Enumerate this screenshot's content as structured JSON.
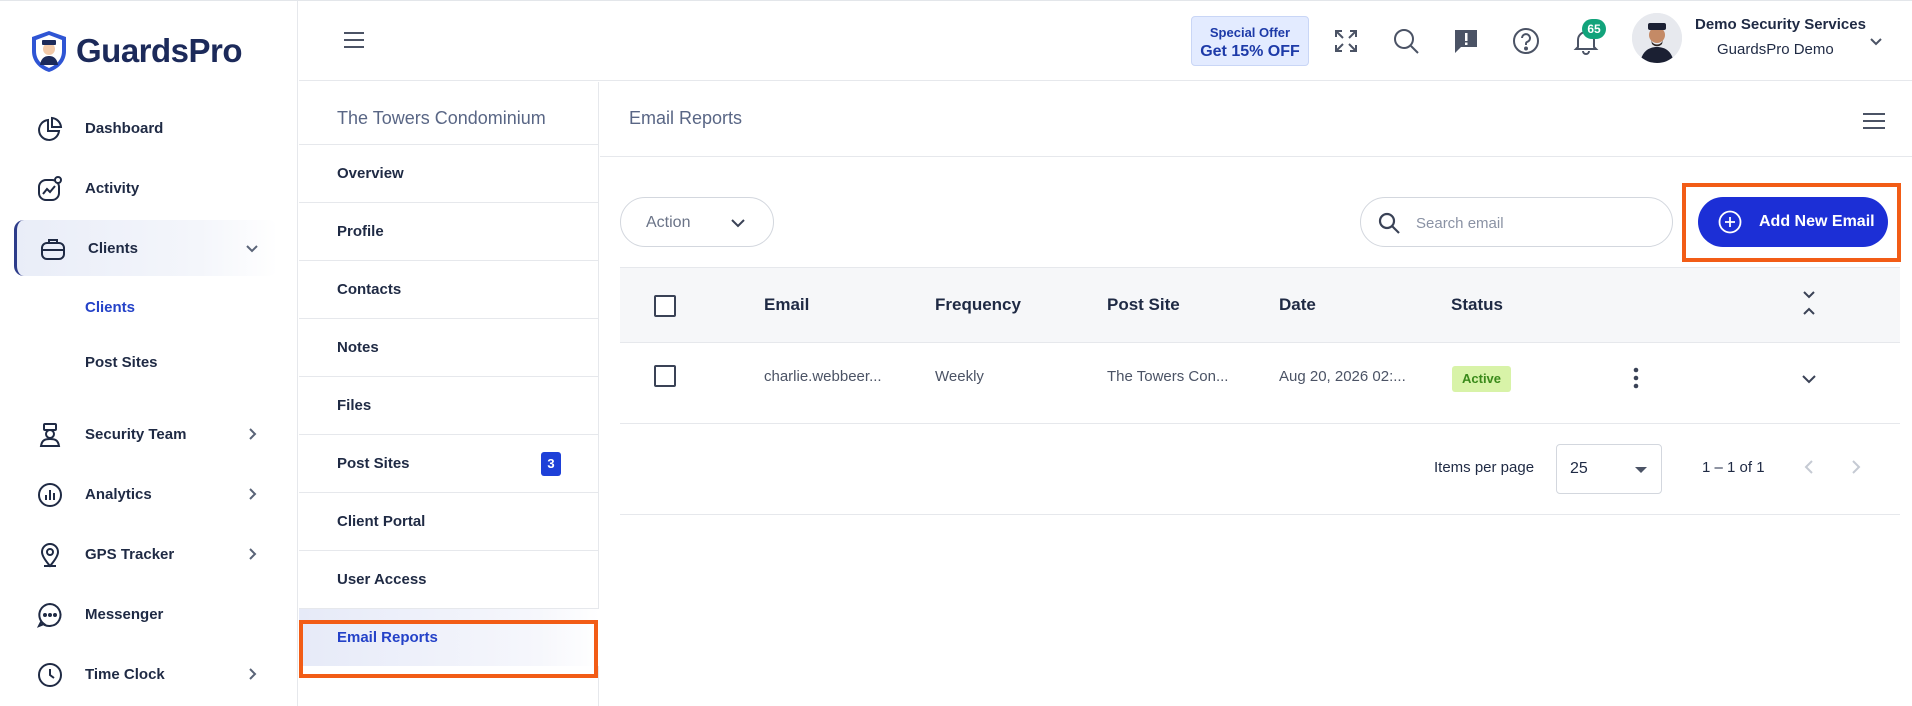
{
  "app": {
    "logo_text": "GuardsPro"
  },
  "sidebar": {
    "items": [
      {
        "label": "Dashboard",
        "icon": "pie-chart-icon"
      },
      {
        "label": "Activity",
        "icon": "activity-chart-icon"
      },
      {
        "label": "Clients",
        "icon": "briefcase-icon",
        "expanded": true
      },
      {
        "label": "Security Team",
        "icon": "guard-icon"
      },
      {
        "label": "Analytics",
        "icon": "analytics-icon"
      },
      {
        "label": "GPS Tracker",
        "icon": "map-pin-icon"
      },
      {
        "label": "Messenger",
        "icon": "chat-bubble-icon"
      },
      {
        "label": "Time Clock",
        "icon": "clock-icon"
      }
    ],
    "sub_items": [
      {
        "label": "Clients",
        "current": true
      },
      {
        "label": "Post Sites",
        "current": false
      }
    ]
  },
  "topbar": {
    "offer_line1": "Special Offer",
    "offer_line2": "Get 15% OFF",
    "notification_count": "65",
    "user_name": "Demo Security Services",
    "user_org": "GuardsPro Demo"
  },
  "client_panel": {
    "title": "The Towers Condominium",
    "items": [
      {
        "label": "Overview"
      },
      {
        "label": "Profile"
      },
      {
        "label": "Contacts"
      },
      {
        "label": "Notes"
      },
      {
        "label": "Files"
      },
      {
        "label": "Post Sites",
        "count": "3"
      },
      {
        "label": "Client Portal"
      },
      {
        "label": "User Access"
      },
      {
        "label": "Email Reports",
        "selected": true
      }
    ]
  },
  "content": {
    "title": "Email Reports",
    "action_label": "Action",
    "search_placeholder": "Search email",
    "add_button_label": "Add New Email",
    "table": {
      "columns": [
        "Email",
        "Frequency",
        "Post Site",
        "Date",
        "Status"
      ],
      "rows": [
        {
          "email": "charlie.webbeer...",
          "frequency": "Weekly",
          "post_site": "The Towers Con...",
          "date": "Aug 20, 2026 02:...",
          "status": "Active"
        }
      ]
    },
    "pagination": {
      "items_per_page_label": "Items per page",
      "items_per_page": "25",
      "range": "1 – 1 of 1"
    }
  },
  "colors": {
    "primary": "#1c2fd6",
    "highlight": "#f25c16",
    "badge_green": "#12a37b",
    "status_active_bg": "#d8f3a8"
  }
}
